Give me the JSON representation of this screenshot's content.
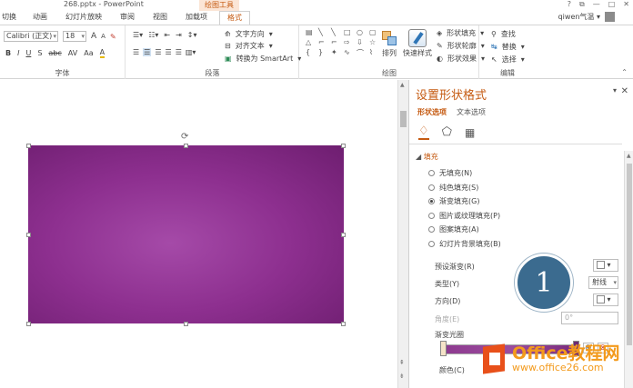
{
  "titlebar": {
    "doc": "268.pptx - PowerPoint",
    "context_tab": "绘图工具",
    "min": "?",
    "restore": "⧉",
    "minimize": "—",
    "maximize": "□",
    "close": "✕"
  },
  "tabs": [
    {
      "label": "切换"
    },
    {
      "label": "动画"
    },
    {
      "label": "幻灯片放映"
    },
    {
      "label": "审阅"
    },
    {
      "label": "视图"
    },
    {
      "label": "加载项"
    },
    {
      "label": "格式",
      "active": true
    }
  ],
  "user": "qiwen气温 ▾",
  "ribbon": {
    "font": {
      "name": "Calibri (正文)",
      "size": "18",
      "grow": "A",
      "shrink": "A",
      "bold": "B",
      "italic": "I",
      "underline": "U",
      "shadow": "S",
      "strike": "abc",
      "spacing": "AV",
      "case": "Aa",
      "color": "A",
      "label": "字体"
    },
    "para": {
      "text_dir": "文字方向",
      "align_text": "对齐文本",
      "smartart": "转换为 SmartArt",
      "label": "段落"
    },
    "draw": {
      "arrange": "排列",
      "quick_styles": "快速样式",
      "fill": "形状填充",
      "outline": "形状轮廓",
      "effects": "形状效果",
      "label": "绘图"
    },
    "edit": {
      "find": "查找",
      "replace": "替换",
      "select": "选择",
      "label": "编辑"
    }
  },
  "panel": {
    "title": "设置形状格式",
    "tabs": [
      "形状选项",
      "文本选项"
    ],
    "section": "填充",
    "radios": [
      {
        "label": "无填充(N)",
        "checked": false
      },
      {
        "label": "纯色填充(S)",
        "checked": false
      },
      {
        "label": "渐变填充(G)",
        "checked": true
      },
      {
        "label": "图片或纹理填充(P)",
        "checked": false
      },
      {
        "label": "图案填充(A)",
        "checked": false
      },
      {
        "label": "幻灯片背景填充(B)",
        "checked": false
      }
    ],
    "preset_label": "预设渐变(R)",
    "type_label": "类型(Y)",
    "type_value": "射线",
    "direction_label": "方向(D)",
    "angle_label": "角度(E)",
    "angle_value": "0°",
    "stops_label": "渐变光圈",
    "color_label": "颜色(C)"
  },
  "callout": "1",
  "watermark": {
    "line1": "Office教程网",
    "line2": "www.office26.com"
  }
}
